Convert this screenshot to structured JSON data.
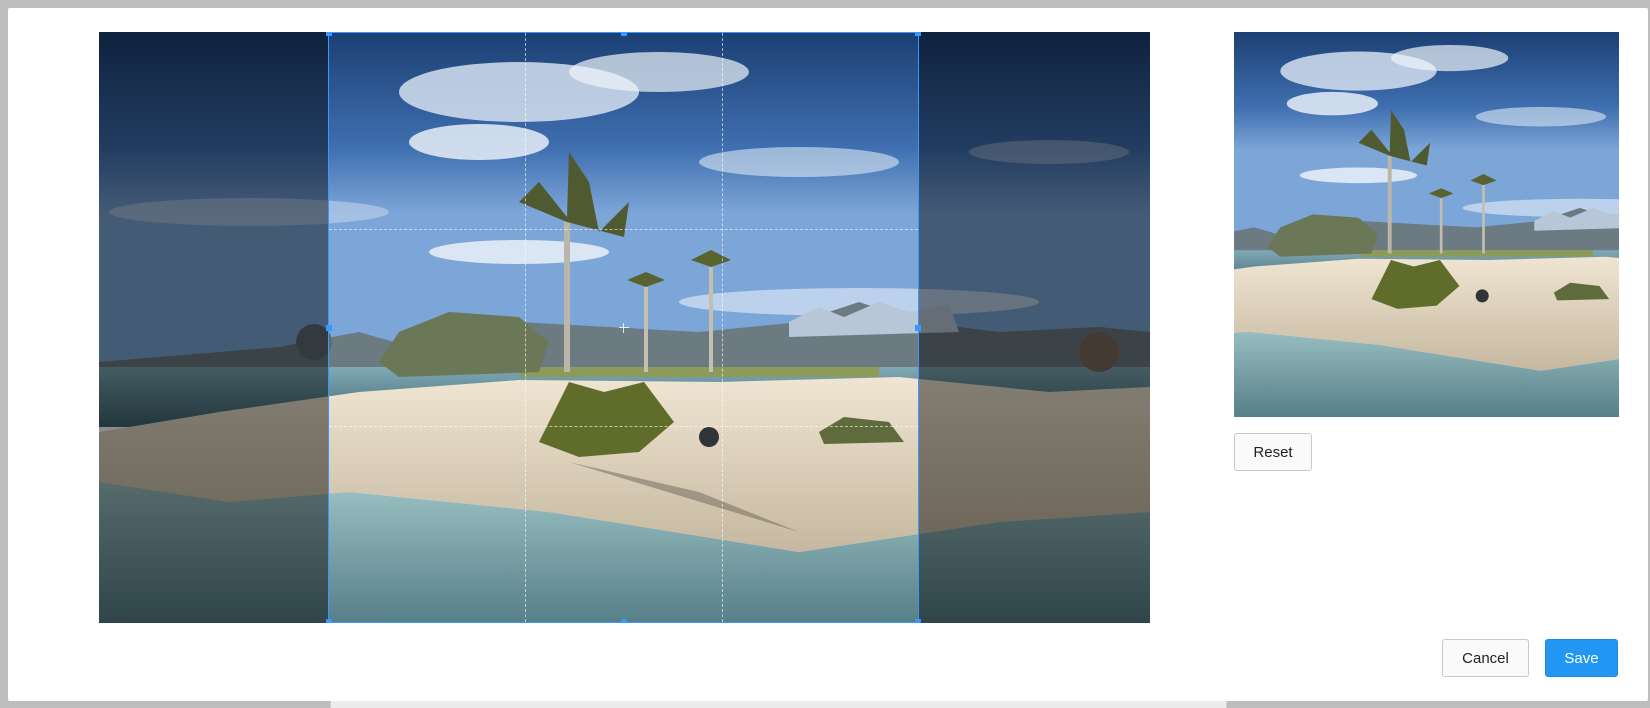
{
  "dialog": {
    "crop_area_label": "crop-area",
    "preview_label": "preview"
  },
  "buttons": {
    "reset": "Reset",
    "cancel": "Cancel",
    "save": "Save"
  },
  "colors": {
    "accent": "#2196f3",
    "crop_border": "#3a97ff"
  }
}
